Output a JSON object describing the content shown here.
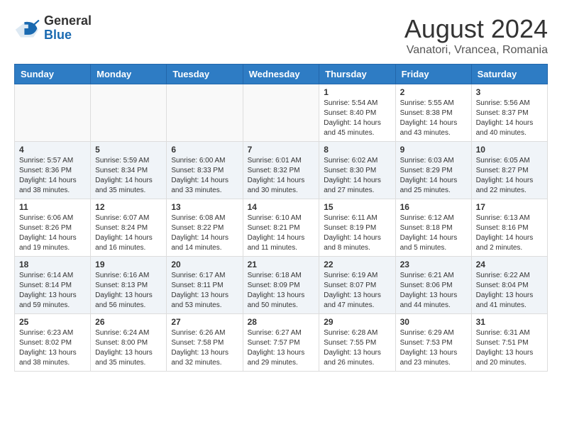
{
  "header": {
    "logo_general": "General",
    "logo_blue": "Blue",
    "main_title": "August 2024",
    "subtitle": "Vanatori, Vrancea, Romania"
  },
  "weekdays": [
    "Sunday",
    "Monday",
    "Tuesday",
    "Wednesday",
    "Thursday",
    "Friday",
    "Saturday"
  ],
  "weeks": [
    [
      {
        "day": "",
        "info": ""
      },
      {
        "day": "",
        "info": ""
      },
      {
        "day": "",
        "info": ""
      },
      {
        "day": "",
        "info": ""
      },
      {
        "day": "1",
        "info": "Sunrise: 5:54 AM\nSunset: 8:40 PM\nDaylight: 14 hours\nand 45 minutes."
      },
      {
        "day": "2",
        "info": "Sunrise: 5:55 AM\nSunset: 8:38 PM\nDaylight: 14 hours\nand 43 minutes."
      },
      {
        "day": "3",
        "info": "Sunrise: 5:56 AM\nSunset: 8:37 PM\nDaylight: 14 hours\nand 40 minutes."
      }
    ],
    [
      {
        "day": "4",
        "info": "Sunrise: 5:57 AM\nSunset: 8:36 PM\nDaylight: 14 hours\nand 38 minutes."
      },
      {
        "day": "5",
        "info": "Sunrise: 5:59 AM\nSunset: 8:34 PM\nDaylight: 14 hours\nand 35 minutes."
      },
      {
        "day": "6",
        "info": "Sunrise: 6:00 AM\nSunset: 8:33 PM\nDaylight: 14 hours\nand 33 minutes."
      },
      {
        "day": "7",
        "info": "Sunrise: 6:01 AM\nSunset: 8:32 PM\nDaylight: 14 hours\nand 30 minutes."
      },
      {
        "day": "8",
        "info": "Sunrise: 6:02 AM\nSunset: 8:30 PM\nDaylight: 14 hours\nand 27 minutes."
      },
      {
        "day": "9",
        "info": "Sunrise: 6:03 AM\nSunset: 8:29 PM\nDaylight: 14 hours\nand 25 minutes."
      },
      {
        "day": "10",
        "info": "Sunrise: 6:05 AM\nSunset: 8:27 PM\nDaylight: 14 hours\nand 22 minutes."
      }
    ],
    [
      {
        "day": "11",
        "info": "Sunrise: 6:06 AM\nSunset: 8:26 PM\nDaylight: 14 hours\nand 19 minutes."
      },
      {
        "day": "12",
        "info": "Sunrise: 6:07 AM\nSunset: 8:24 PM\nDaylight: 14 hours\nand 16 minutes."
      },
      {
        "day": "13",
        "info": "Sunrise: 6:08 AM\nSunset: 8:22 PM\nDaylight: 14 hours\nand 14 minutes."
      },
      {
        "day": "14",
        "info": "Sunrise: 6:10 AM\nSunset: 8:21 PM\nDaylight: 14 hours\nand 11 minutes."
      },
      {
        "day": "15",
        "info": "Sunrise: 6:11 AM\nSunset: 8:19 PM\nDaylight: 14 hours\nand 8 minutes."
      },
      {
        "day": "16",
        "info": "Sunrise: 6:12 AM\nSunset: 8:18 PM\nDaylight: 14 hours\nand 5 minutes."
      },
      {
        "day": "17",
        "info": "Sunrise: 6:13 AM\nSunset: 8:16 PM\nDaylight: 14 hours\nand 2 minutes."
      }
    ],
    [
      {
        "day": "18",
        "info": "Sunrise: 6:14 AM\nSunset: 8:14 PM\nDaylight: 13 hours\nand 59 minutes."
      },
      {
        "day": "19",
        "info": "Sunrise: 6:16 AM\nSunset: 8:13 PM\nDaylight: 13 hours\nand 56 minutes."
      },
      {
        "day": "20",
        "info": "Sunrise: 6:17 AM\nSunset: 8:11 PM\nDaylight: 13 hours\nand 53 minutes."
      },
      {
        "day": "21",
        "info": "Sunrise: 6:18 AM\nSunset: 8:09 PM\nDaylight: 13 hours\nand 50 minutes."
      },
      {
        "day": "22",
        "info": "Sunrise: 6:19 AM\nSunset: 8:07 PM\nDaylight: 13 hours\nand 47 minutes."
      },
      {
        "day": "23",
        "info": "Sunrise: 6:21 AM\nSunset: 8:06 PM\nDaylight: 13 hours\nand 44 minutes."
      },
      {
        "day": "24",
        "info": "Sunrise: 6:22 AM\nSunset: 8:04 PM\nDaylight: 13 hours\nand 41 minutes."
      }
    ],
    [
      {
        "day": "25",
        "info": "Sunrise: 6:23 AM\nSunset: 8:02 PM\nDaylight: 13 hours\nand 38 minutes."
      },
      {
        "day": "26",
        "info": "Sunrise: 6:24 AM\nSunset: 8:00 PM\nDaylight: 13 hours\nand 35 minutes."
      },
      {
        "day": "27",
        "info": "Sunrise: 6:26 AM\nSunset: 7:58 PM\nDaylight: 13 hours\nand 32 minutes."
      },
      {
        "day": "28",
        "info": "Sunrise: 6:27 AM\nSunset: 7:57 PM\nDaylight: 13 hours\nand 29 minutes."
      },
      {
        "day": "29",
        "info": "Sunrise: 6:28 AM\nSunset: 7:55 PM\nDaylight: 13 hours\nand 26 minutes."
      },
      {
        "day": "30",
        "info": "Sunrise: 6:29 AM\nSunset: 7:53 PM\nDaylight: 13 hours\nand 23 minutes."
      },
      {
        "day": "31",
        "info": "Sunrise: 6:31 AM\nSunset: 7:51 PM\nDaylight: 13 hours\nand 20 minutes."
      }
    ]
  ]
}
